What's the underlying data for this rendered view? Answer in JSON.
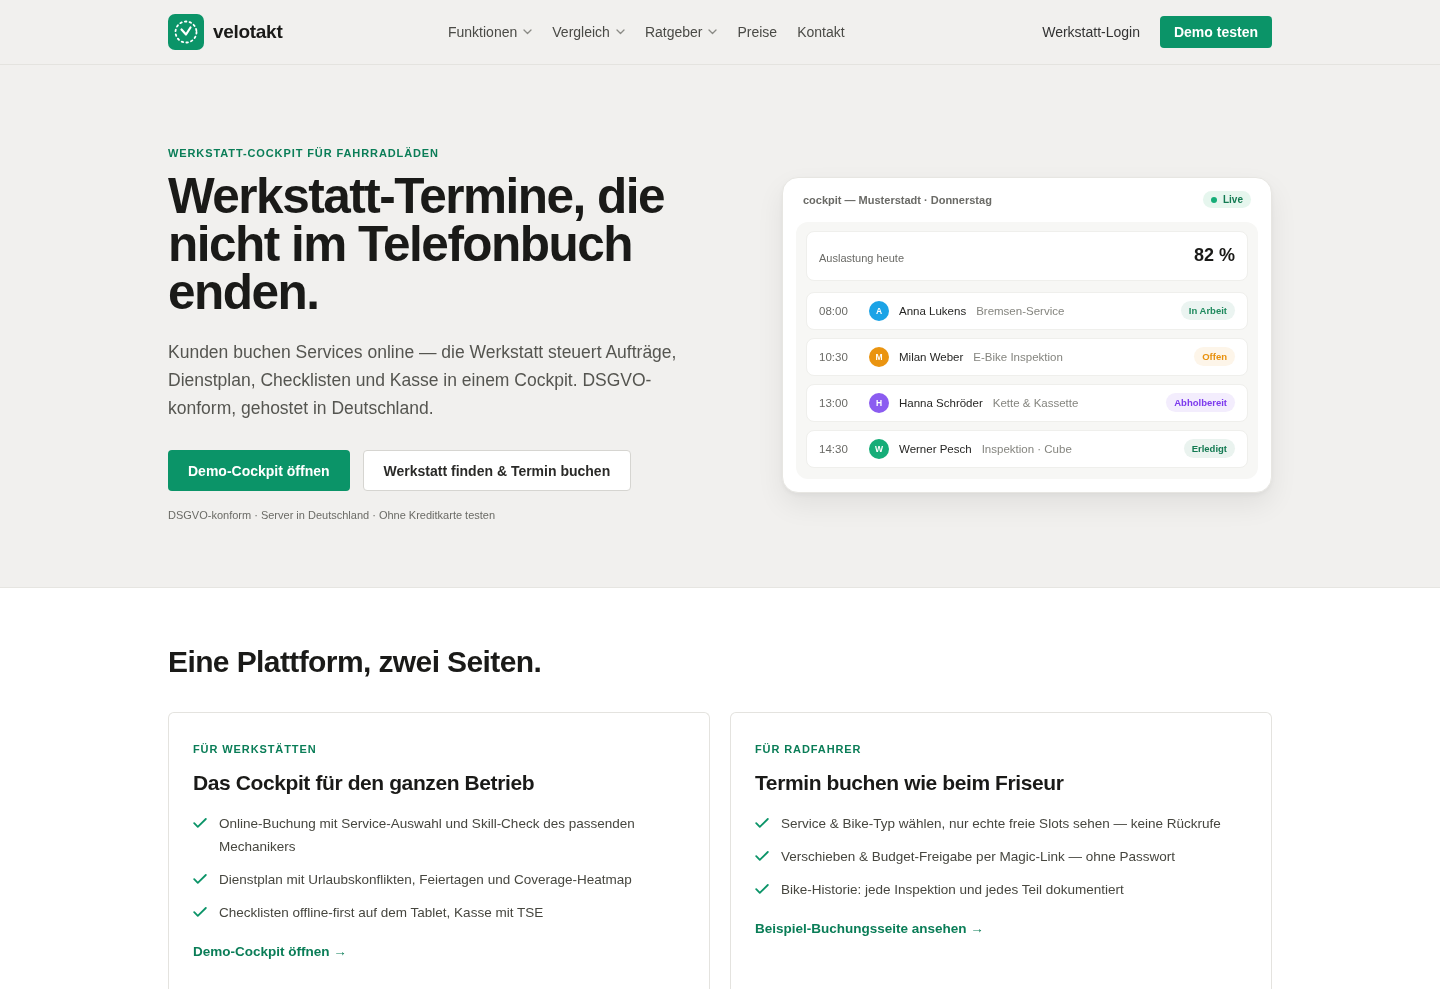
{
  "header": {
    "brand": "velotakt",
    "nav": [
      {
        "label": "Funktionen",
        "dropdown": true
      },
      {
        "label": "Vergleich",
        "dropdown": true
      },
      {
        "label": "Ratgeber",
        "dropdown": true
      },
      {
        "label": "Preise",
        "dropdown": false
      },
      {
        "label": "Kontakt",
        "dropdown": false
      }
    ],
    "login": "Werkstatt-Login",
    "cta": "Demo testen"
  },
  "hero": {
    "eyebrow": "WERKSTATT-COCKPIT FÜR FAHRRADLÄDEN",
    "title": "Werkstatt-Termine, die nicht im Telefonbuch enden.",
    "lead": "Kunden buchen Services online — die Werkstatt steuert Aufträge, Dienstplan, Checklisten und Kasse in einem Cockpit. DSGVO-konform, gehostet in Deutschland.",
    "buttons": [
      {
        "label": "Demo-Cockpit öffnen",
        "kind": "primary"
      },
      {
        "label": "Werkstatt finden & Termin buchen",
        "kind": "secondary"
      }
    ],
    "note": "DSGVO-konform · Server in Deutschland · Ohne Kreditkarte testen"
  },
  "cockpit": {
    "title": "cockpit — Musterstadt · Donnerstag",
    "live": "Live",
    "utilization": {
      "label": "Auslastung heute",
      "value": "82 %"
    },
    "appointments": [
      {
        "time": "08:00",
        "avatar": {
          "initial": "A",
          "color": "#1ba3e6"
        },
        "name": "Anna Lukens",
        "service": "Bremsen-Service",
        "status": {
          "label": "In Arbeit",
          "color": "#1f8a5e"
        }
      },
      {
        "time": "10:30",
        "avatar": {
          "initial": "M",
          "color": "#ea9410"
        },
        "name": "Milan Weber",
        "service": "E-Bike Inspektion",
        "status": {
          "label": "Offen",
          "color": "#e8900c"
        }
      },
      {
        "time": "13:00",
        "avatar": {
          "initial": "H",
          "color": "#8b5cf0"
        },
        "name": "Hanna Schröder",
        "service": "Kette & Kassette",
        "status": {
          "label": "Abholbereit",
          "color": "#7c3aed"
        }
      },
      {
        "time": "14:30",
        "avatar": {
          "initial": "W",
          "color": "#16ad78"
        },
        "name": "Werner Pesch",
        "service": "Inspektion · Cube",
        "status": {
          "label": "Erledigt",
          "color": "#137a52"
        }
      }
    ]
  },
  "platform": {
    "title": "Eine Plattform, zwei Seiten.",
    "cards": [
      {
        "eyebrow": "FÜR WERKSTÄTTEN",
        "title": "Das Cockpit für den ganzen Betrieb",
        "features": [
          "Online-Buchung mit Service-Auswahl und Skill-Check des passenden Mechanikers",
          "Dienstplan mit Urlaubskonflikten, Feiertagen und Coverage-Heatmap",
          "Checklisten offline-first auf dem Tablet, Kasse mit TSE"
        ],
        "link": "Demo-Cockpit öffnen →"
      },
      {
        "eyebrow": "FÜR RADFAHRER",
        "title": "Termin buchen wie beim Friseur",
        "features": [
          "Service & Bike-Typ wählen, nur echte freie Slots sehen — keine Rückrufe",
          "Verschieben & Budget-Freigabe per Magic-Link — ohne Passwort",
          "Bike-Historie: jede Inspektion und jedes Teil dokumentiert"
        ],
        "link": "Beispiel-Buchungsseite ansehen →"
      }
    ]
  }
}
